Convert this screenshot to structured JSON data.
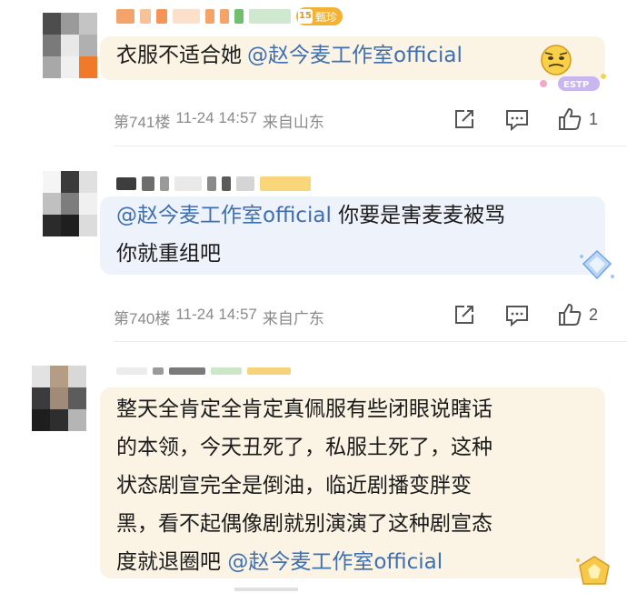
{
  "comments": [
    {
      "level_badge": "15",
      "level_name": "甄珍",
      "text": "衣服不适合她",
      "mention": "@赵今麦工作室official",
      "emoji": "ESTP",
      "floor": "第741楼",
      "time": "11-24 14:57",
      "location": "来自山东",
      "likes": "1"
    },
    {
      "mention": "@赵今麦工作室official",
      "text_after_mention": " 你要是害麦麦被骂",
      "text_line2": "你就重组吧",
      "floor": "第740楼",
      "time": "11-24 14:57",
      "location": "来自广东",
      "likes": "2"
    },
    {
      "text_lines": [
        "整天全肯定全肯定真佩服有些闭眼说瞎话",
        "的本领，今天丑死了，私服土死了，这种",
        "状态剧宣完全是倒油，临近剧播变胖变",
        "黑，看不起偶像剧就别演演了这种剧宣态"
      ],
      "last_line_text": "度就退圈吧 ",
      "mention": "@赵今麦工作室official"
    }
  ],
  "colors": {
    "bubble1": "#fbf4e4",
    "bubble2": "#edf2fb",
    "bubble3": "#fbf4e4",
    "mention": "#3e6fb0"
  }
}
